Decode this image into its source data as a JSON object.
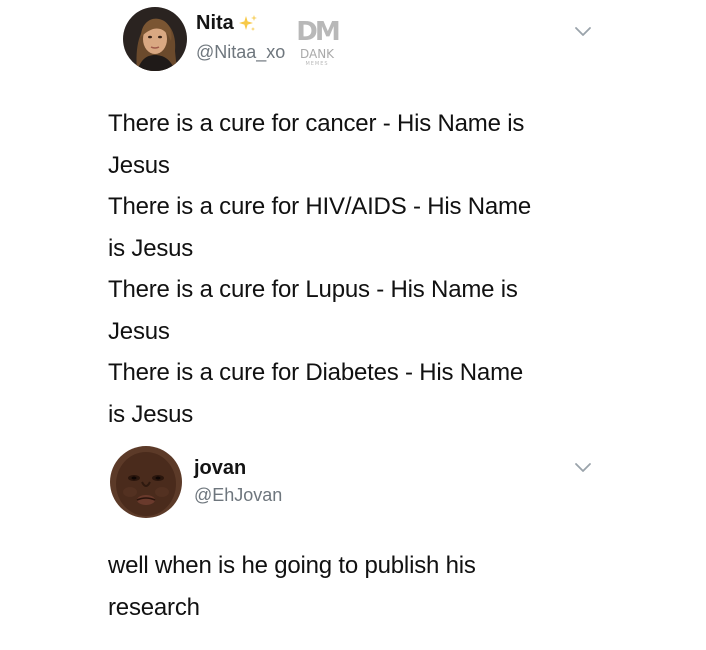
{
  "tweets": [
    {
      "author": {
        "name": "Nita",
        "handle": "@Nitaa_xo"
      },
      "lines": [
        "There is a cure for cancer - His Name is",
        "Jesus",
        "There is a cure for HIV/AIDS - His Name",
        "is Jesus",
        "There is a cure for Lupus - His Name is",
        "Jesus",
        "There is a cure for Diabetes - His Name",
        "is Jesus"
      ]
    },
    {
      "author": {
        "name": "jovan",
        "handle": "@EhJovan"
      },
      "lines": [
        "well when is he going to publish his",
        "research"
      ]
    }
  ],
  "watermark": {
    "mark": "DM",
    "text": "DANK",
    "subtext": "MEMES"
  },
  "icons": {
    "name_emoji": "sparkles-icon",
    "menu": "chevron-down-icon"
  },
  "colors": {
    "text": "#111111",
    "handle": "#6e767d",
    "sparkle": "#f7c948",
    "chevron": "#9aa3ab"
  }
}
